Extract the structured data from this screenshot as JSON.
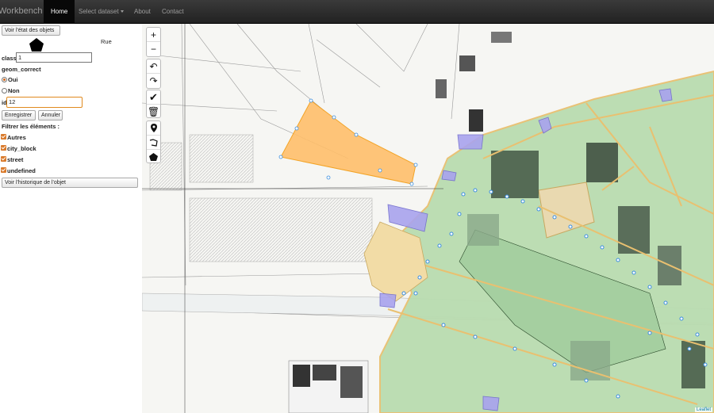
{
  "navbar": {
    "brand": "Workbench",
    "items": [
      {
        "label": "Home",
        "active": true
      },
      {
        "label": "Select dataset",
        "dropdown": true
      },
      {
        "label": "About"
      },
      {
        "label": "Contact"
      }
    ]
  },
  "panel": {
    "state_button": "Voir l'état des objets",
    "selected_label": "Rue",
    "class_label": "class",
    "class_value": "1",
    "geom_label": "geom_correct",
    "radio_yes": "Oui",
    "radio_no": "Non",
    "id_label": "id",
    "id_value": "12",
    "save_button": "Enregistrer",
    "cancel_button": "Annuler",
    "filter_title": "Filtrer les éléments :",
    "filters": [
      "Autres",
      "city_block",
      "street",
      "undefined"
    ],
    "history_button": "Voir l'historique de l'objet"
  },
  "map": {
    "zoom_in": "+",
    "zoom_out": "−",
    "attribution": "Leaflet"
  },
  "colors": {
    "navbar": "#222222",
    "selected_polygon": "#ffb347",
    "city_block": "#a8d5a2",
    "street_points": "#3a8dde",
    "street_polygon": "#9999ee"
  }
}
